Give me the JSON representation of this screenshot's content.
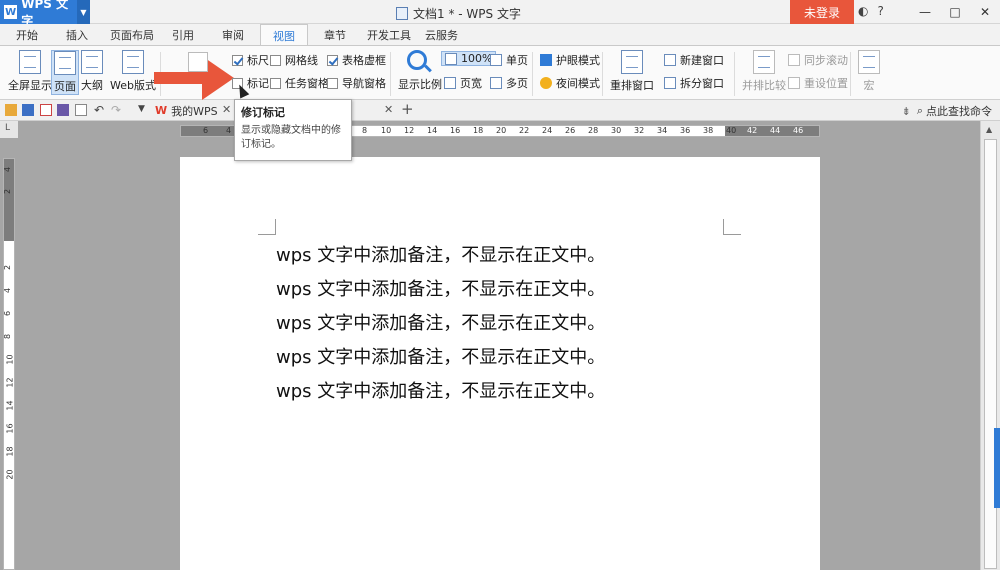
{
  "app": {
    "name": "WPS 文字",
    "logo": "W",
    "doc_title": "文档1 * - WPS 文字",
    "login": "未登录"
  },
  "titlebar": {
    "skin_icon": "◐",
    "help": "?",
    "minimize": "—",
    "restore": "□",
    "close": "✕"
  },
  "menu": [
    "开始",
    "插入",
    "页面布局",
    "引用",
    "审阅",
    "视图",
    "章节",
    "开发工具",
    "云服务"
  ],
  "ribbon": {
    "fullscreen": "全屏显示",
    "page_view": "页面",
    "outline": "大纲",
    "web_view": "Web版式",
    "checks": {
      "ruler": "标尺",
      "gridlines": "网格线",
      "table_grid": "表格虚框",
      "marks": "标记",
      "task_pane": "任务窗格",
      "nav_pane": "导航窗格"
    },
    "zoom": "显示比例",
    "zoom_level": "100%",
    "page_width": "页宽",
    "single_page": "单页",
    "multi_page": "多页",
    "eye_mode": "护眼模式",
    "night_mode": "夜间模式",
    "arrange": "重排窗口",
    "new_window": "新建窗口",
    "split_window": "拆分窗口",
    "side_by_side": "并排比较",
    "sync_scroll": "同步滚动",
    "reset_position": "重设位置",
    "macro": "宏"
  },
  "doctabs": {
    "my_wps": "我的WPS",
    "add": "+",
    "search_cmd": "点此查找命令"
  },
  "tooltip": {
    "title": "修订标记",
    "desc": "显示或隐藏文档中的修订标记。"
  },
  "ruler_h": [
    "6",
    "4",
    "2",
    "8",
    "10",
    "12",
    "14",
    "16",
    "18",
    "20",
    "22",
    "24",
    "26",
    "28",
    "30",
    "32",
    "34",
    "36",
    "38",
    "40",
    "42",
    "44",
    "46"
  ],
  "ruler_v": [
    "4",
    "2",
    "2",
    "4",
    "6",
    "8",
    "10",
    "12",
    "14",
    "16",
    "18",
    "20"
  ],
  "document": {
    "lines": [
      "wps 文字中添加备注，不显示在正文中。",
      "wps 文字中添加备注，不显示在正文中。",
      "wps 文字中添加备注，不显示在正文中。",
      "wps 文字中添加备注，不显示在正文中。",
      "wps 文字中添加备注，不显示在正文中。"
    ]
  },
  "colors": {
    "accent": "#2f7bd6",
    "login": "#e8563b",
    "arrow": "#e8563b"
  }
}
